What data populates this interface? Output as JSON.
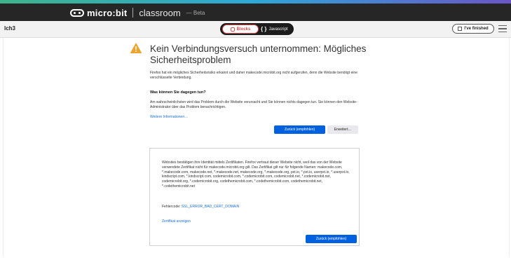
{
  "topbar": {
    "brand_name": "micro:bit",
    "brand_product": "classroom",
    "brand_badge": "— Beta"
  },
  "subbar": {
    "project_name": "lch3",
    "mode_blocks": "Blocks",
    "mode_javascript": "Javascript",
    "mode_js_glyph": "{ }",
    "finished_label": "I've finished"
  },
  "error": {
    "title": "Kein Verbindungsversuch unternommen: Mögliches Sicherheitsproblem",
    "intro": "Firefox hat ein mögliches Sicherheitsrisiko erkannt und daher makecode.microbit.org nicht aufgerufen, denn die Website benötigt eine verschlüsselte Verbindung.",
    "what_heading": "Was können Sie dagegen tun?",
    "what_text": "Am wahrscheinlichsten wird das Problem durch die Website verursacht und Sie können nichts dagegen tun. Sie können den Website-Administrator über das Problem benachrichtigen.",
    "more_info_link": "Weitere Informationen…",
    "back_button": "Zurück (empfohlen)",
    "advanced_button": "Erweitert…"
  },
  "advanced": {
    "details": "Websites bestätigen ihre Identität mittels Zertifikaten. Firefox vertraut dieser Website nicht, weil das von der Website verwendete Zertifikat nicht für makecode.microbit.org gilt. Das Zertifikat gilt nur für folgende Namen: makecode.com, *.makecode.com, makecode.net, *.makecode.net, makecode.org, *.makecode.org, pxt.io, *.pxt.io, userpxt.io, *.userpxt.io, kindscript.com, *.kindscript.com, codemicrobit.com, *.codemicrobit.com, codemicrobit.net, *.codemicrobit.net, codemicrobit.org, *.codemicrobit.org, codethemicrobit.com, *.codethemicrobit.com, codethemicrobit.net, *.codethemicrobit.net",
    "error_code_label": "Fehlercode:",
    "error_code": "SSL_ERROR_BAD_CERT_DOMAIN",
    "view_cert_link": "Zertifikat anzeigen",
    "back_button": "Zurück (empfohlen)"
  },
  "colors": {
    "primary_button": "#0061e0",
    "warning": "#f0a32b",
    "link": "#1a6fd6",
    "topbar": "#262626"
  },
  "icons": {
    "warning": "warning-triangle-icon",
    "blocks": "puzzle-icon",
    "finished": "checkbox-icon",
    "menu": "hamburger-menu-icon"
  }
}
